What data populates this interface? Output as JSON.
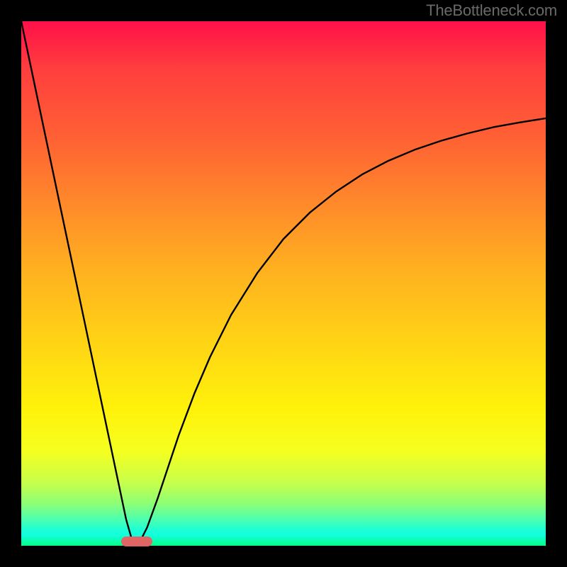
{
  "watermark": "TheBottleneck.com",
  "chart_data": {
    "type": "line",
    "title": "",
    "xlabel": "",
    "ylabel": "",
    "xlim": [
      0,
      100
    ],
    "ylim": [
      0,
      100
    ],
    "grid": false,
    "legend": false,
    "background": "gradient-heat-vertical",
    "series": [
      {
        "name": "curve",
        "x": [
          0,
          2,
          4,
          6,
          8,
          10,
          12,
          14,
          16,
          18,
          20,
          21,
          22,
          23,
          24,
          26,
          28,
          30,
          33,
          36,
          40,
          45,
          50,
          55,
          60,
          65,
          70,
          75,
          80,
          85,
          90,
          95,
          100
        ],
        "y": [
          100,
          90.5,
          81,
          71.5,
          62,
          52.5,
          43,
          33.5,
          24,
          14.5,
          5,
          1.5,
          0.8,
          1.5,
          3.5,
          9,
          15,
          21,
          29,
          36,
          44,
          52,
          58.5,
          63.5,
          67.5,
          70.8,
          73.4,
          75.5,
          77.2,
          78.6,
          79.8,
          80.7,
          81.5
        ]
      }
    ],
    "marker": {
      "x": 22,
      "y": 0.8
    },
    "gradient_stops": [
      {
        "pos": 0.0,
        "color": "#ff1049"
      },
      {
        "pos": 0.5,
        "color": "#ffd614"
      },
      {
        "pos": 0.82,
        "color": "#f5ff20"
      },
      {
        "pos": 1.0,
        "color": "#08ff85"
      }
    ]
  }
}
